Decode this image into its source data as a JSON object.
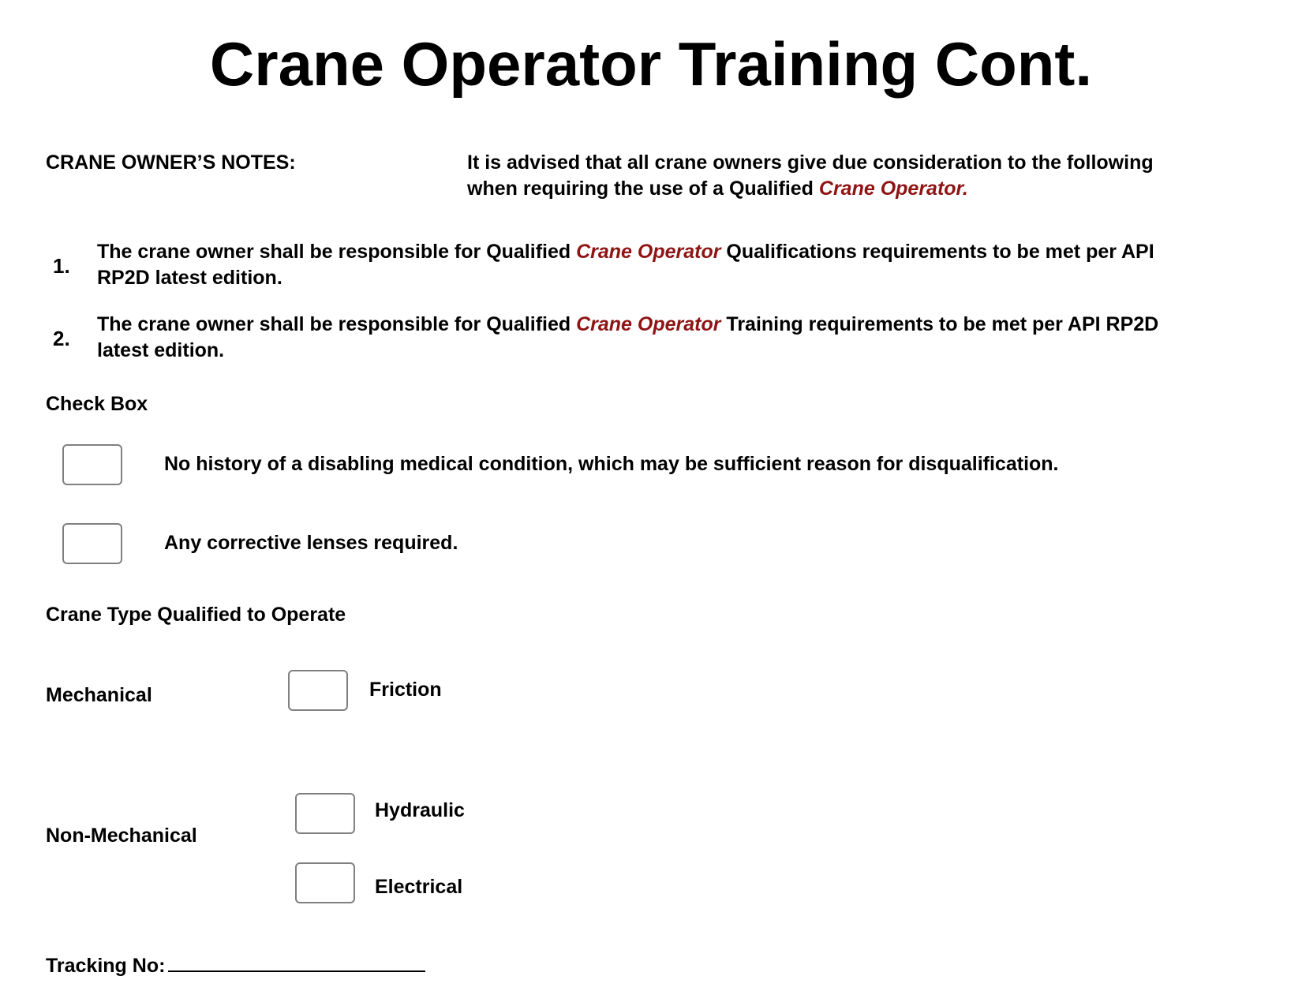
{
  "title": "Crane Operator Training Cont.",
  "owner_notes": {
    "label": "CRANE OWNER’S NOTES:",
    "intro_line1": "It is advised that all crane owners give due consideration to the following",
    "intro_line2_pre": "when requiring the use of a Qualified ",
    "intro_line2_red": "Crane Operator.",
    "accent_color": "#8f1414"
  },
  "list": [
    {
      "number": "1.",
      "pre": "The crane owner shall be responsible for Qualified ",
      "red": "Crane Operator",
      "post": " Qualifications requirements to be met per API",
      "line2": "RP2D latest edition."
    },
    {
      "number": "2.",
      "pre": "The crane owner shall be responsible for Qualified ",
      "red": "Crane Operator",
      "post": " Training requirements to be met per API RP2D",
      "line2": "latest edition."
    }
  ],
  "check_box": {
    "heading": "Check Box",
    "items": [
      "No history of a disabling medical condition, which may be sufficient reason for disqualification.",
      "Any corrective lenses required."
    ]
  },
  "crane_type": {
    "heading": "Crane Type Qualified to Operate",
    "mechanical_label": "Mechanical",
    "mechanical_options": [
      "Friction"
    ],
    "non_mechanical_label": "Non-Mechanical",
    "non_mechanical_options": [
      "Hydraulic",
      "Electrical"
    ]
  },
  "tracking": {
    "label": "Tracking No:",
    "value": ""
  }
}
